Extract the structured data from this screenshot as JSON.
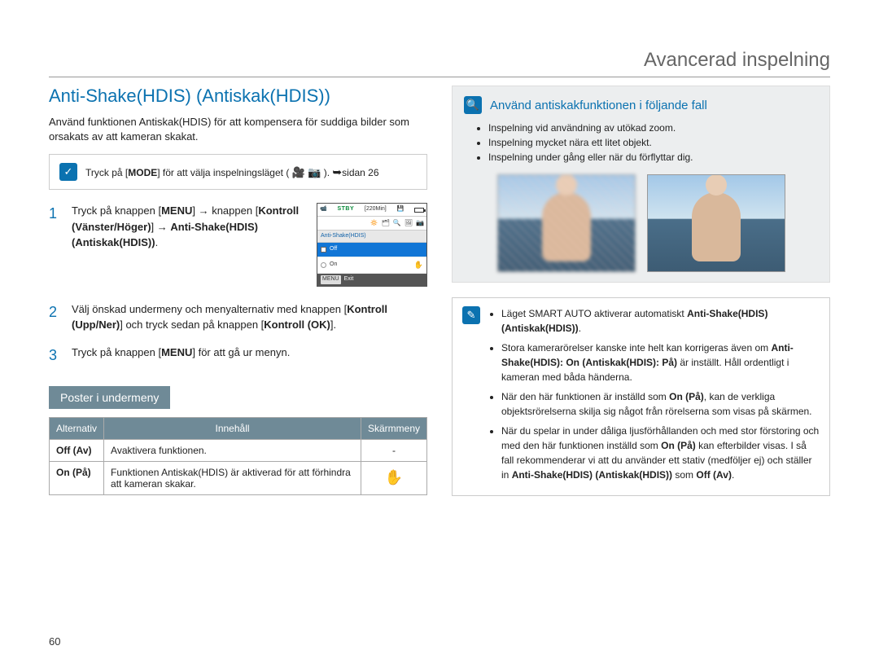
{
  "header": {
    "title": "Avancerad inspelning"
  },
  "section": {
    "title": "Anti-Shake(HDIS) (Antiskak(HDIS))",
    "intro": "Använd funktionen Antiskak(HDIS) för att kompensera för suddiga bilder som orsakats av att kameran skakat."
  },
  "mode_box": {
    "prefix": "Tryck på [",
    "mode_label": "MODE",
    "mid": "] för att välja inspelningsläget (",
    "suffix": ").",
    "page_ref": "sidan 26"
  },
  "lcd": {
    "stby": "STBY",
    "time": "[220Min]",
    "title": "Anti-Shake(HDIS)",
    "off": "Off",
    "on": "On",
    "menu": "MENU",
    "exit": "Exit"
  },
  "steps": [
    {
      "num": "1",
      "parts": {
        "a": "Tryck på knappen [",
        "b": "MENU",
        "c": "] ",
        "d": " knappen [",
        "e": "Kontroll (Vänster/Höger)",
        "f": "] ",
        "g": " ",
        "h": "Anti-Shake(HDIS) (Antiskak(HDIS))",
        "i": "."
      }
    },
    {
      "num": "2",
      "parts": {
        "a": "Välj önskad undermeny och menyalternativ med knappen [",
        "b": "Kontroll (Upp/Ner)",
        "c": "] och tryck sedan på knappen [",
        "d": "Kontroll (OK)",
        "e": "]."
      }
    },
    {
      "num": "3",
      "parts": {
        "a": "Tryck på knappen [",
        "b": "MENU",
        "c": "] för att gå ur menyn."
      }
    }
  ],
  "submenu": {
    "bar_label": "Poster i undermeny",
    "headers": {
      "alt": "Alternativ",
      "content": "Innehåll",
      "screen": "Skärmmeny"
    },
    "rows": [
      {
        "alt": "Off (Av)",
        "content": "Avaktivera funktionen.",
        "screen": "-"
      },
      {
        "alt": "On (På)",
        "content": "Funktionen Antiskak(HDIS) är aktiverad för att förhindra att kameran skakar.",
        "screen_icon": "hand"
      }
    ]
  },
  "callout": {
    "title": "Använd antiskakfunktionen i följande fall",
    "items": [
      "Inspelning vid användning av utökad zoom.",
      "Inspelning mycket nära ett litet objekt.",
      "Inspelning under gång eller när du förflyttar dig."
    ]
  },
  "notes": [
    {
      "pre": "Läget SMART AUTO aktiverar automatiskt ",
      "bold": "Anti-Shake(HDIS) (Antiskak(HDIS))",
      "post": "."
    },
    {
      "pre": "Stora kamerarörelser kanske inte helt kan korrigeras även om ",
      "bold": "Anti-Shake(HDIS): On (Antiskak(HDIS): På)",
      "post": " är inställt. Håll ordentligt i kameran med båda händerna."
    },
    {
      "pre": "När den här funktionen är inställd som ",
      "bold": "On (På)",
      "post": ", kan de verkliga objektsrörelserna skilja sig något från rörelserna som visas på skärmen."
    },
    {
      "pre": "När du spelar in under dåliga ljusförhållanden och med stor förstoring och med den här funktionen inställd som ",
      "bold": "On (På)",
      "post_a": " kan efterbilder visas. I så fall rekommenderar vi att du använder ett stativ (medföljer ej) och ställer in ",
      "bold_b": "Anti-Shake(HDIS) (Antiskak(HDIS))",
      "post_b": " som ",
      "bold_c": "Off (Av)",
      "post_c": "."
    }
  ],
  "page_number": "60"
}
